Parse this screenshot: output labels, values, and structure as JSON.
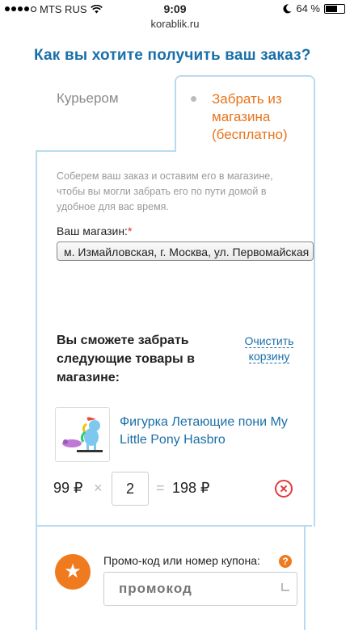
{
  "status_bar": {
    "carrier": "MTS RUS",
    "time": "9:09",
    "battery_text": "64 %",
    "battery_level": 0.64
  },
  "browser": {
    "url": "korablik.ru"
  },
  "page": {
    "title": "Как вы хотите получить ваш заказ?"
  },
  "tabs": {
    "courier_label": "Курьером",
    "pickup_label": "Забрать из магазина (бесплатно)",
    "active": "pickup"
  },
  "pickup_panel": {
    "info_text": "Соберем ваш заказ и оставим его в магазине, чтобы вы могли забрать его по пути домой в удобное для вас время.",
    "store_label": "Ваш магазин:",
    "required_mark": "*",
    "store_value": "м. Измайловская, г. Москва, ул. Первомайская",
    "heading": "Вы сможете забрать следующие товары в магазине:",
    "clear_cart": "Очистить корзину"
  },
  "cart_item": {
    "name": "Фигурка Летающие пони My Little Pony Hasbro",
    "price": "99 ₽",
    "times": "×",
    "quantity": "2",
    "equals": "=",
    "total": "198 ₽"
  },
  "promo": {
    "label": "Промо-код или номер купона:",
    "help": "?",
    "placeholder": "промокод",
    "star": "★"
  },
  "colors": {
    "title_blue": "#1a6fa8",
    "accent_orange": "#e8741c",
    "border_blue": "#b9dbef",
    "remove_red": "#e23b3b"
  },
  "icons": [
    "signal-dots-icon",
    "wifi-icon",
    "moon-icon",
    "battery-icon",
    "radio-icon",
    "remove-icon",
    "star-icon",
    "help-icon",
    "resize-icon"
  ]
}
